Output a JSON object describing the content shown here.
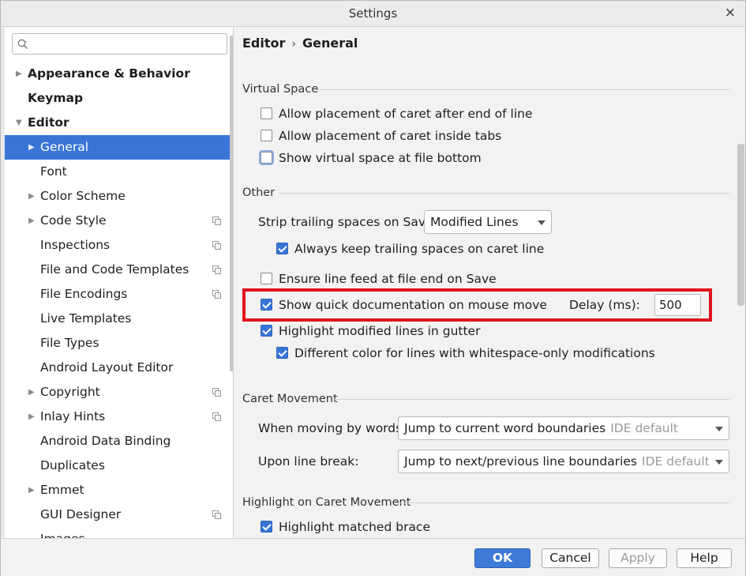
{
  "window": {
    "title": "Settings",
    "close_glyph": "×"
  },
  "search": {
    "placeholder": "",
    "icon": "search-icon"
  },
  "sidebar": {
    "items": [
      {
        "label": "Appearance & Behavior",
        "bold": true,
        "expandable": true,
        "level": 0
      },
      {
        "label": "Keymap",
        "bold": true,
        "expandable": false,
        "level": 0
      },
      {
        "label": "Editor",
        "bold": true,
        "expandable": true,
        "expanded": true,
        "level": 0
      },
      {
        "label": "General",
        "expandable": true,
        "level": 1,
        "selected": true
      },
      {
        "label": "Font",
        "expandable": false,
        "level": 1
      },
      {
        "label": "Color Scheme",
        "expandable": true,
        "level": 1
      },
      {
        "label": "Code Style",
        "expandable": true,
        "level": 1,
        "project_icon": true
      },
      {
        "label": "Inspections",
        "expandable": false,
        "level": 1,
        "project_icon": true
      },
      {
        "label": "File and Code Templates",
        "expandable": false,
        "level": 1,
        "project_icon": true
      },
      {
        "label": "File Encodings",
        "expandable": false,
        "level": 1,
        "project_icon": true
      },
      {
        "label": "Live Templates",
        "expandable": false,
        "level": 1
      },
      {
        "label": "File Types",
        "expandable": false,
        "level": 1
      },
      {
        "label": "Android Layout Editor",
        "expandable": false,
        "level": 1
      },
      {
        "label": "Copyright",
        "expandable": true,
        "level": 1,
        "project_icon": true
      },
      {
        "label": "Inlay Hints",
        "expandable": true,
        "level": 1,
        "project_icon": true
      },
      {
        "label": "Android Data Binding",
        "expandable": false,
        "level": 1
      },
      {
        "label": "Duplicates",
        "expandable": false,
        "level": 1
      },
      {
        "label": "Emmet",
        "expandable": true,
        "level": 1
      },
      {
        "label": "GUI Designer",
        "expandable": false,
        "level": 1,
        "project_icon": true
      },
      {
        "label": "Images",
        "expandable": false,
        "level": 1
      }
    ]
  },
  "breadcrumb": {
    "parent": "Editor",
    "separator": "›",
    "current": "General"
  },
  "virtual_space": {
    "title": "Virtual Space",
    "options": [
      {
        "label": "Allow placement of caret after end of line",
        "checked": false
      },
      {
        "label": "Allow placement of caret inside tabs",
        "checked": false
      },
      {
        "label": "Show virtual space at file bottom",
        "checked": false,
        "focused": true
      }
    ]
  },
  "other": {
    "title": "Other",
    "strip_label": "Strip trailing spaces on Save:",
    "strip_value": "Modified Lines",
    "keep_trailing": {
      "label": "Always keep trailing spaces on caret line",
      "checked": true
    },
    "ensure_lf": {
      "label": "Ensure line feed at file end on Save",
      "checked": false
    },
    "quick_doc": {
      "label": "Show quick documentation on mouse move",
      "checked": true
    },
    "delay_label": "Delay (ms):",
    "delay_value": "500",
    "highlight_modified": {
      "label": "Highlight modified lines in gutter",
      "checked": true
    },
    "different_color": {
      "label": "Different color for lines with whitespace-only modifications",
      "checked": true
    }
  },
  "caret_movement": {
    "title": "Caret Movement",
    "words_label": "When moving by words:",
    "words_value": "Jump to current word boundaries",
    "words_hint": "IDE default",
    "linebreak_label": "Upon line break:",
    "linebreak_value": "Jump to next/previous line boundaries",
    "linebreak_hint": "IDE default"
  },
  "highlight_caret": {
    "title": "Highlight on Caret Movement",
    "matched_brace": {
      "label": "Highlight matched brace",
      "checked": true
    }
  },
  "buttons": {
    "ok": "OK",
    "cancel": "Cancel",
    "apply": "Apply",
    "help": "Help"
  },
  "colors": {
    "selection": "#3875d7",
    "highlight_border": "#e1121f",
    "primary_button": "#3d7bd9"
  }
}
